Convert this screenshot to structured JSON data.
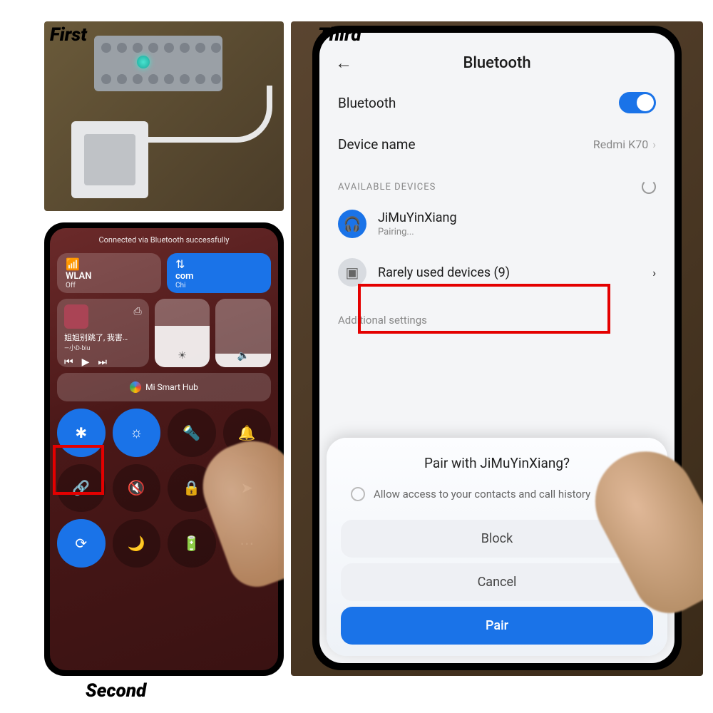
{
  "step_labels": {
    "first": "First",
    "second": "Second",
    "third": "Third"
  },
  "panel2": {
    "notification": "Connected via Bluetooth successfully",
    "wlan": {
      "label": "WLAN",
      "status": "Off"
    },
    "data": {
      "label": "com",
      "carrier": "Chi"
    },
    "media": {
      "title": "姐姐别跳了, 我害…",
      "artist": "—小D-biu"
    },
    "hub": "Mi Smart Hub",
    "toggles": {
      "bluetooth": "bluetooth",
      "brightness": "brightness",
      "flashlight": "flashlight",
      "bell": "notifications",
      "link": "link",
      "mute": "mute",
      "lock": "lock",
      "location": "location",
      "rotate": "rotate-lock",
      "dnd": "dnd",
      "battery": "battery",
      "more": "more"
    }
  },
  "panel3": {
    "title": "Bluetooth",
    "bt_label": "Bluetooth",
    "device_name_label": "Device name",
    "device_name_value": "Redmi K70",
    "available_header": "AVAILABLE DEVICES",
    "device1": {
      "name": "JiMuYinXiang",
      "status": "Pairing..."
    },
    "rarely_used": "Rarely used devices (9)",
    "additional": "Additional settings",
    "sheet": {
      "title": "Pair with JiMuYinXiang?",
      "checkbox": "Allow access to your contacts and call history",
      "block": "Block",
      "cancel": "Cancel",
      "pair": "Pair"
    }
  }
}
